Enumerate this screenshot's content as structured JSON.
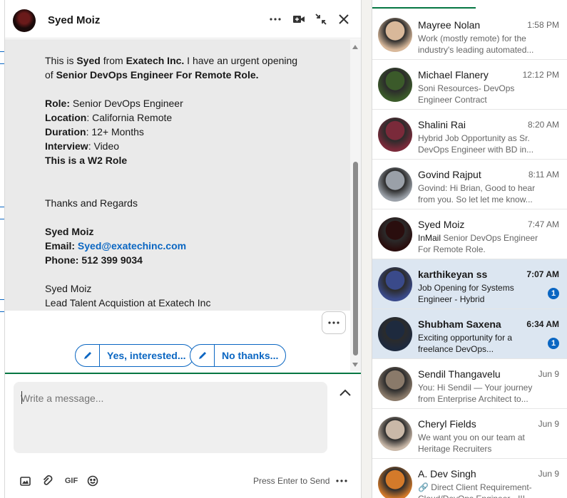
{
  "chat": {
    "contact_name": "Syed Moiz",
    "header_icons": [
      "more-icon",
      "video-call-icon",
      "minimize-icon",
      "close-icon"
    ],
    "message_lines": [
      {
        "parts": [
          {
            "t": " This is ",
            "b": false
          },
          {
            "t": "Syed",
            "b": true
          },
          {
            "t": " from ",
            "b": false
          },
          {
            "t": "Exatech Inc.",
            "b": true
          },
          {
            "t": " I have an urgent opening",
            "b": false
          }
        ]
      },
      {
        "parts": [
          {
            "t": "of  ",
            "b": false
          },
          {
            "t": "Senior DevOps Engineer For Remote Role.",
            "b": true
          }
        ]
      },
      {
        "parts": []
      },
      {
        "parts": [
          {
            "t": "Role:",
            "b": true
          },
          {
            "t": " Senior DevOps Engineer",
            "b": false
          }
        ]
      },
      {
        "parts": [
          {
            "t": "Location",
            "b": true
          },
          {
            "t": ": California Remote",
            "b": false
          }
        ]
      },
      {
        "parts": [
          {
            "t": " Duration",
            "b": true
          },
          {
            "t": ": 12+ Months",
            "b": false
          }
        ]
      },
      {
        "parts": [
          {
            "t": " Interview",
            "b": true
          },
          {
            "t": ": Video",
            "b": false
          }
        ]
      },
      {
        "parts": [
          {
            "t": "This is a W2 Role",
            "b": true
          }
        ]
      },
      {
        "parts": []
      },
      {
        "parts": []
      },
      {
        "parts": [
          {
            "t": "Thanks and Regards",
            "b": false
          }
        ]
      },
      {
        "parts": []
      },
      {
        "parts": [
          {
            "t": "Syed Moiz",
            "b": true
          }
        ]
      },
      {
        "parts": [
          {
            "t": "Email: ",
            "b": true
          },
          {
            "t": "Syed@exatechinc.com",
            "b": true,
            "link": true
          }
        ]
      },
      {
        "parts": [
          {
            "t": "Phone: 512 399 9034",
            "b": true
          }
        ]
      },
      {
        "parts": []
      },
      {
        "parts": [
          {
            "t": "Syed Moiz",
            "b": false
          }
        ]
      },
      {
        "parts": [
          {
            "t": "Lead Talent Acquistion at Exatech Inc",
            "b": false
          }
        ]
      }
    ],
    "quick_replies": [
      "Yes, interested...",
      "No thanks..."
    ],
    "composer_placeholder": "Write a message...",
    "footer": {
      "gif_label": "GIF",
      "press_enter": "Press Enter to Send"
    }
  },
  "conversations": [
    {
      "name": "Mayree Nolan",
      "time": "1:58 PM",
      "preview": "Work (mostly remote) for the industry's leading automated...",
      "unread": false,
      "badge": "",
      "avatar_color": "#d8b89a"
    },
    {
      "name": "Michael Flanery",
      "time": "12:12 PM",
      "preview": "Soni Resources- DevOps Engineer Contract",
      "unread": false,
      "badge": "",
      "avatar_color": "#3b5a2a"
    },
    {
      "name": "Shalini Rai",
      "time": "8:20 AM",
      "preview": "Hybrid Job Opportunity as Sr. DevOps Engineer with BD in...",
      "unread": false,
      "badge": "",
      "avatar_color": "#7a2a3a"
    },
    {
      "name": "Govind Rajput",
      "time": "8:11 AM",
      "preview": "Govind: Hi Brian, Good to hear from you. So let let me know...",
      "unread": false,
      "badge": "",
      "avatar_color": "#9aa0a8"
    },
    {
      "name": "Syed Moiz",
      "time": "7:47 AM",
      "preview_tag": "InMail",
      "preview": "Senior DevOps Engineer For Remote Role.",
      "unread": false,
      "badge": "",
      "avatar_color": "#2a0e0e"
    },
    {
      "name": "karthikeyan ss",
      "time": "7:07 AM",
      "preview": "Job Opening for Systems Engineer - Hybrid",
      "unread": true,
      "badge": "1",
      "avatar_color": "#3a4a8a"
    },
    {
      "name": "Shubham Saxena",
      "time": "6:34 AM",
      "preview": "Exciting opportunity for a freelance DevOps...",
      "unread": true,
      "badge": "1",
      "avatar_color": "#1e2a3e"
    },
    {
      "name": "Sendil Thangavelu",
      "time": "Jun 9",
      "preview": "You: Hi Sendil — Your journey from Enterprise Architect to...",
      "unread": false,
      "badge": "",
      "avatar_color": "#8a7a6a"
    },
    {
      "name": "Cheryl Fields",
      "time": "Jun 9",
      "preview": "We want you on our team at Heritage Recruiters",
      "unread": false,
      "badge": "",
      "avatar_color": "#c9b8a8"
    },
    {
      "name": "A. Dev Singh",
      "time": "Jun 9",
      "preview": "🔗 Direct Client Requirement- Cloud/DevOps Engineer - !!!",
      "unread": false,
      "badge": "",
      "avatar_color": "#d47a2a"
    }
  ]
}
